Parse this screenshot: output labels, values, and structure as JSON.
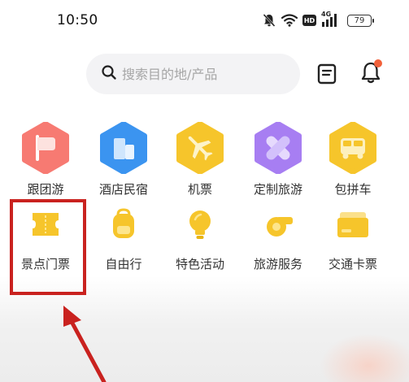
{
  "status_bar": {
    "time": "10:50",
    "network_label": "4G",
    "hd_label": "HD",
    "battery": "79"
  },
  "search": {
    "placeholder": "搜索目的地/产品",
    "value": ""
  },
  "icons": {
    "notification_dot_color": "#f2613a",
    "highlight_color": "#c9221f"
  },
  "categories_row1": [
    {
      "label": "跟团游",
      "icon": "flag-icon",
      "color": "#f77a72"
    },
    {
      "label": "酒店民宿",
      "icon": "building-icon",
      "color": "#3b94f0"
    },
    {
      "label": "机票",
      "icon": "airplane-icon",
      "color": "#f6c52b"
    },
    {
      "label": "定制旅游",
      "icon": "bandage-icon",
      "color": "#a77ef2"
    },
    {
      "label": "包拼车",
      "icon": "bus-icon",
      "color": "#f6c52b"
    }
  ],
  "categories_row2": [
    {
      "label": "景点门票",
      "icon": "ticket-icon",
      "color": "#f6c52b"
    },
    {
      "label": "自由行",
      "icon": "backpack-icon",
      "color": "#f6c52b"
    },
    {
      "label": "特色活动",
      "icon": "lightbulb-icon",
      "color": "#f6c52b"
    },
    {
      "label": "旅游服务",
      "icon": "whistle-icon",
      "color": "#f6c52b"
    },
    {
      "label": "交通卡票",
      "icon": "card-icon",
      "color": "#f6c52b"
    }
  ]
}
